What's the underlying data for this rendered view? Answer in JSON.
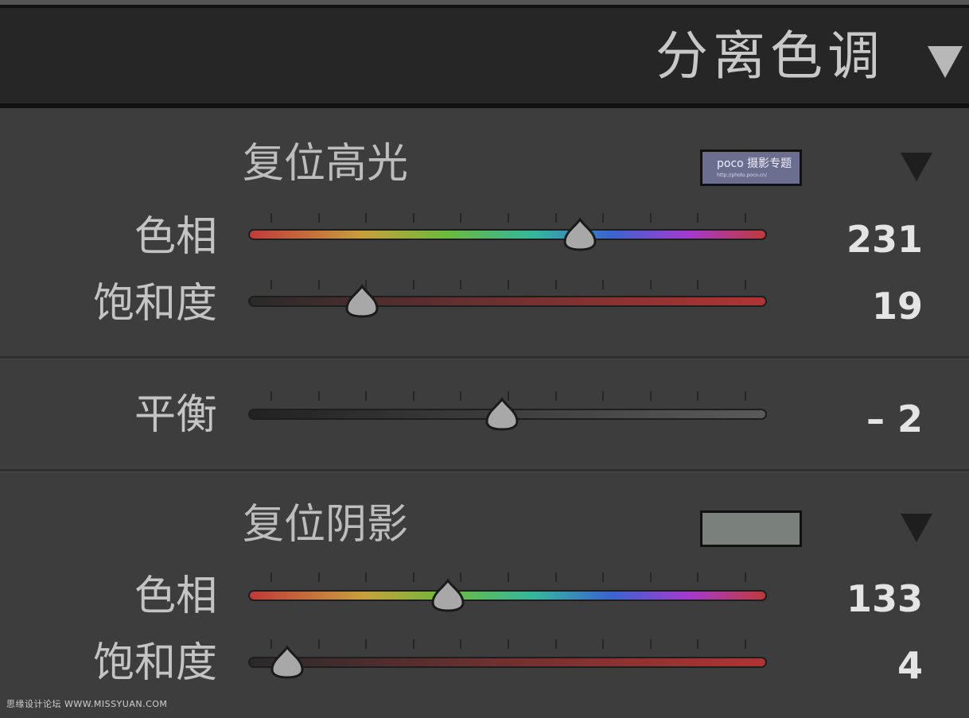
{
  "header": {
    "title": "分离色调"
  },
  "highlights": {
    "reset_label": "复位高光",
    "swatch_color": "#6b6e8e",
    "swatch_logo": "poco 摄影专题",
    "swatch_logo_sub": "http://photo.poco.cn/",
    "hue": {
      "label": "色相",
      "value": "231",
      "position": 0.64
    },
    "saturation": {
      "label": "饱和度",
      "value": "19",
      "position": 0.22
    }
  },
  "balance": {
    "label": "平衡",
    "value": "– 2",
    "position": 0.49
  },
  "shadows": {
    "reset_label": "复位阴影",
    "swatch_color": "#7a807c",
    "hue": {
      "label": "色相",
      "value": "133",
      "position": 0.385
    },
    "saturation": {
      "label": "饱和度",
      "value": "4",
      "position": 0.075
    }
  },
  "footer": {
    "watermark": "思缘设计论坛 WWW.MISSYUAN.COM"
  }
}
